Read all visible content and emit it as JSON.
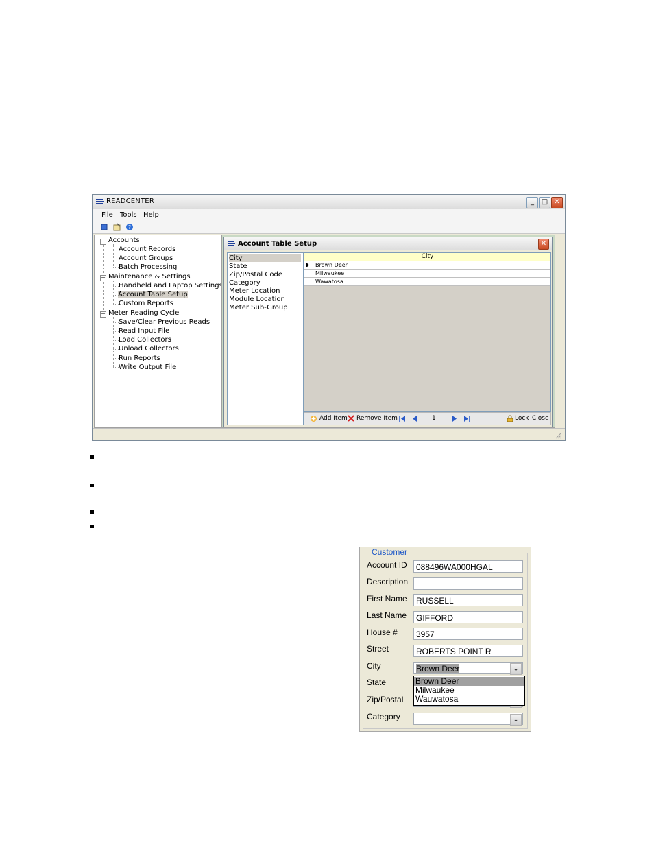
{
  "window": {
    "title": "READCENTER",
    "controls": {
      "minimize": "_",
      "maximize": "□",
      "close": "✕"
    },
    "menu": [
      "File",
      "Tools",
      "Help"
    ]
  },
  "tree": {
    "groups": [
      {
        "label": "Accounts",
        "expander": "−",
        "children": [
          "Account Records",
          "Account Groups",
          "Batch Processing"
        ]
      },
      {
        "label": "Maintenance & Settings",
        "expander": "−",
        "children": [
          "Handheld and Laptop Settings",
          "Account Table Setup",
          "Custom Reports"
        ]
      },
      {
        "label": "Meter Reading Cycle",
        "expander": "−",
        "children": [
          "Save/Clear Previous Reads",
          "Read Input File",
          "Load Collectors",
          "Unload Collectors",
          "Run Reports",
          "Write Output File"
        ]
      }
    ],
    "selected": "Account Table Setup"
  },
  "dialog": {
    "title": "Account Table Setup",
    "close": "✕",
    "tables": [
      "City",
      "State",
      "Zip/Postal Code",
      "Category",
      "Meter Location",
      "Module Location",
      "Meter Sub-Group"
    ],
    "selected_table": "City",
    "grid": {
      "column": "City",
      "rows": [
        "Brown Deer",
        "Milwaukee",
        "Wawatosa"
      ]
    },
    "navigator": {
      "add": "Add Item",
      "remove": "Remove Item",
      "position": "1",
      "lock": "Lock",
      "close": "Close"
    }
  },
  "customer": {
    "legend": "Customer",
    "fields": [
      {
        "label": "Account ID",
        "value": "088496WA000HGAL"
      },
      {
        "label": "Description",
        "value": ""
      },
      {
        "label": "First Name",
        "value": "RUSSELL"
      },
      {
        "label": "Last Name",
        "value": "GIFFORD"
      },
      {
        "label": "House #",
        "value": "3957"
      },
      {
        "label": "Street",
        "value": "ROBERTS POINT R"
      },
      {
        "label": "City",
        "value": "Brown Deer"
      },
      {
        "label": "State",
        "value": ""
      },
      {
        "label": "Zip/Postal",
        "value": ""
      },
      {
        "label": "Category",
        "value": ""
      }
    ],
    "city_dropdown_options": [
      "Brown Deer",
      "Milwaukee",
      "Wauwatosa"
    ],
    "city_dropdown_selected": "Brown Deer"
  },
  "colors": {
    "legend": "#1c57c8",
    "grid_header": "#ffffc8",
    "mdi_background": "#c9d9c4"
  }
}
